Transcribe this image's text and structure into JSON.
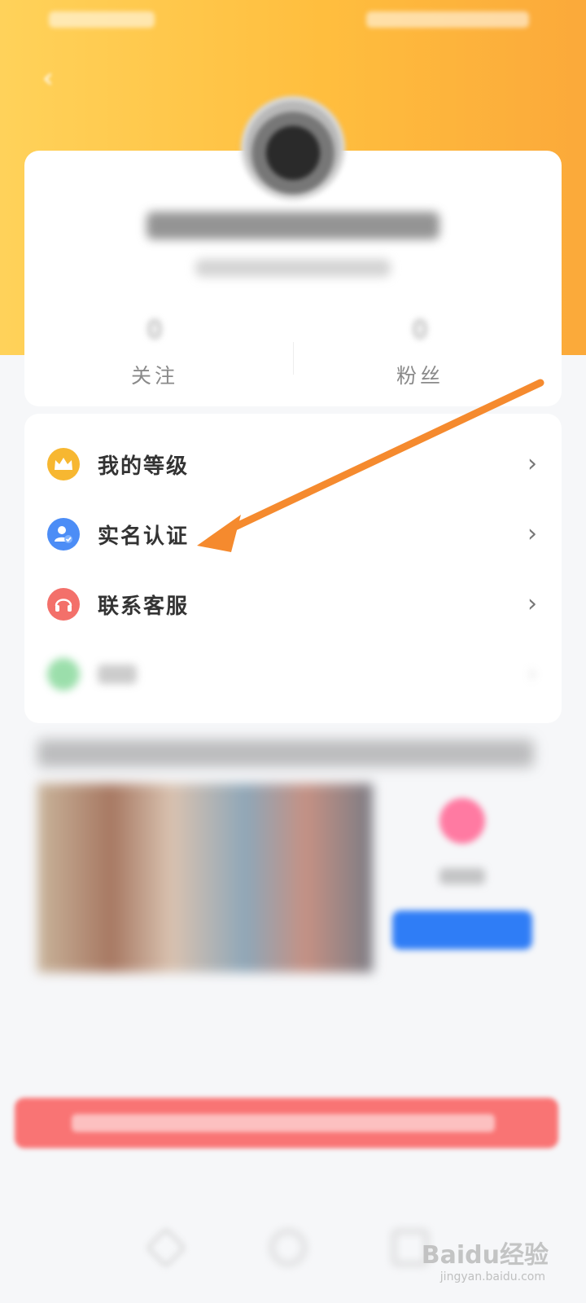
{
  "profile": {
    "stats": [
      {
        "label": "关注",
        "count": "0"
      },
      {
        "label": "粉丝",
        "count": "0"
      }
    ]
  },
  "menu": {
    "items": [
      {
        "label": "我的等级",
        "icon": "crown-icon",
        "color": "#f7b731"
      },
      {
        "label": "实名认证",
        "icon": "verified-user-icon",
        "color": "#4c8df6"
      },
      {
        "label": "联系客服",
        "icon": "headset-icon",
        "color": "#f3706a"
      }
    ]
  },
  "watermark": {
    "logo": "Baidu经验",
    "url": "jingyan.baidu.com"
  },
  "colors": {
    "header_gradient_start": "#ffd25a",
    "header_gradient_end": "#fba93a",
    "annotation_arrow": "#f58a2e"
  }
}
